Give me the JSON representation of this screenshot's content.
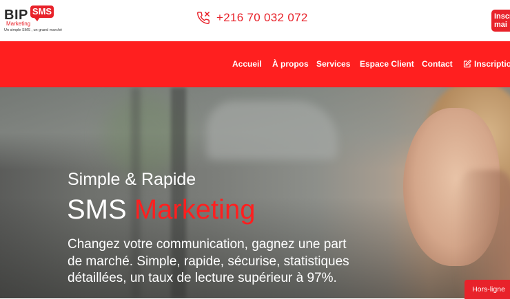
{
  "brand": {
    "name_left": "BIP",
    "name_bubble": "SMS",
    "name_sub": "Marketing",
    "tagline": "Un simple SMS , un grand marché",
    "accent_color": "#e8222a",
    "nav_color": "#ff1f1f"
  },
  "header": {
    "phone_icon": "phone-icon",
    "phone": "+216 70 032 072",
    "signup_badge": "Inscr\nmai"
  },
  "nav": {
    "items": [
      {
        "label": "Accueil"
      },
      {
        "label": "À propos"
      },
      {
        "label": "Services"
      },
      {
        "label": "Espace Client"
      },
      {
        "label": "Contact"
      },
      {
        "label": "Inscription",
        "icon": "edit-icon"
      }
    ]
  },
  "hero": {
    "subtitle": "Simple & Rapide",
    "title_white": "SMS",
    "title_red": "Marketing",
    "text": "Changez votre communication, gagnez une part de marché. Simple, rapide, sécurise, statistiques détaillées, un taux de lecture supérieur à 97%."
  },
  "chat": {
    "label": "Hors-ligne"
  }
}
